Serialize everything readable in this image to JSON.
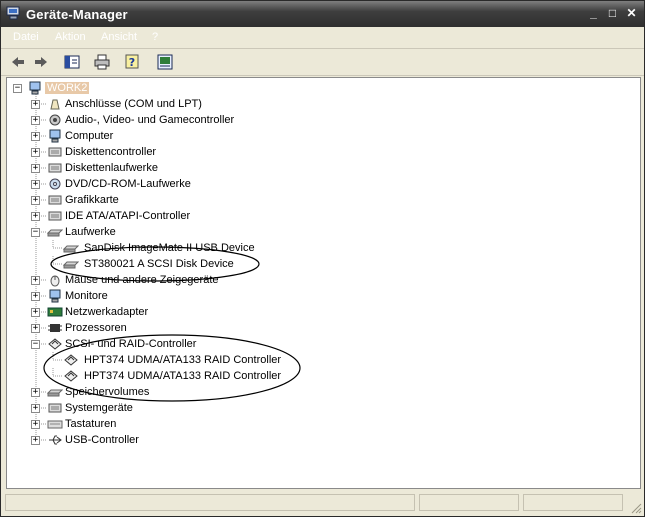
{
  "window": {
    "title": "Geräte-Manager"
  },
  "title_buttons": {
    "minimize": "_",
    "maximize": "□",
    "close": "✕"
  },
  "menu": [
    "Datei",
    "Aktion",
    "Ansicht",
    "?"
  ],
  "toolbar_icons": [
    "back-arrow-icon",
    "forward-arrow-icon",
    "console-tree-icon",
    "print-icon",
    "help-icon",
    "properties-icon"
  ],
  "tree": {
    "root": "WORK2",
    "items": [
      {
        "label": "Anschlüsse (COM und LPT)",
        "icon": "port-icon",
        "level": 1,
        "expander": "+"
      },
      {
        "label": "Audio-, Video- und Gamecontroller",
        "icon": "audio-icon",
        "level": 1,
        "expander": "+"
      },
      {
        "label": "Computer",
        "icon": "computer-icon",
        "level": 1,
        "expander": "+"
      },
      {
        "label": "Diskettencontroller",
        "icon": "floppy-controller-icon",
        "level": 1,
        "expander": "+"
      },
      {
        "label": "Diskettenlaufwerke",
        "icon": "floppy-drive-icon",
        "level": 1,
        "expander": "+"
      },
      {
        "label": "DVD/CD-ROM-Laufwerke",
        "icon": "cdrom-icon",
        "level": 1,
        "expander": "+"
      },
      {
        "label": "Grafikkarte",
        "icon": "display-adapter-icon",
        "level": 1,
        "expander": "+"
      },
      {
        "label": "IDE ATA/ATAPI-Controller",
        "icon": "ide-controller-icon",
        "level": 1,
        "expander": "+"
      },
      {
        "label": "Laufwerke",
        "icon": "disk-drive-icon",
        "level": 1,
        "expander": "−"
      },
      {
        "label": "SanDisk ImageMate II USB Device",
        "icon": "disk-drive-icon",
        "level": 2
      },
      {
        "label": "ST380021 A SCSI Disk Device",
        "icon": "disk-drive-icon",
        "level": 2
      },
      {
        "label": "Mäuse und andere Zeigegeräte",
        "icon": "mouse-icon",
        "level": 1,
        "expander": "+"
      },
      {
        "label": "Monitore",
        "icon": "monitor-icon",
        "level": 1,
        "expander": "+"
      },
      {
        "label": "Netzwerkadapter",
        "icon": "network-adapter-icon",
        "level": 1,
        "expander": "+"
      },
      {
        "label": "Prozessoren",
        "icon": "processor-icon",
        "level": 1,
        "expander": "+"
      },
      {
        "label": "SCSI- und RAID-Controller",
        "icon": "scsi-controller-icon",
        "level": 1,
        "expander": "−"
      },
      {
        "label": "HPT374 UDMA/ATA133 RAID Controller",
        "icon": "scsi-controller-icon",
        "level": 2
      },
      {
        "label": "HPT374 UDMA/ATA133 RAID Controller",
        "icon": "scsi-controller-icon",
        "level": 2
      },
      {
        "label": "Speichervolumes",
        "icon": "storage-volume-icon",
        "level": 1,
        "expander": "+"
      },
      {
        "label": "Systemgeräte",
        "icon": "system-device-icon",
        "level": 1,
        "expander": "+"
      },
      {
        "label": "Tastaturen",
        "icon": "keyboard-icon",
        "level": 1,
        "expander": "+"
      },
      {
        "label": "USB-Controller",
        "icon": "usb-icon",
        "level": 1,
        "expander": "+"
      }
    ]
  },
  "statusbar": {
    "panels": [
      "",
      "",
      ""
    ]
  }
}
